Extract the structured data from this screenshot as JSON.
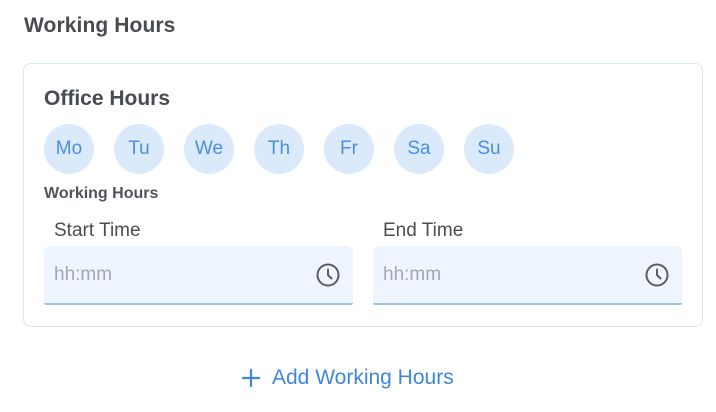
{
  "section": {
    "title": "Working Hours"
  },
  "card": {
    "title": "Office Hours",
    "days": [
      "Mo",
      "Tu",
      "We",
      "Th",
      "Fr",
      "Sa",
      "Su"
    ],
    "subtitle": "Working Hours",
    "start": {
      "label": "Start Time",
      "value": "",
      "placeholder": "hh:mm",
      "icon": "clock-icon"
    },
    "end": {
      "label": "End Time",
      "value": "",
      "placeholder": "hh:mm",
      "icon": "clock-icon"
    }
  },
  "add_button": {
    "icon": "plus-icon",
    "label": "Add Working Hours"
  },
  "colors": {
    "accent": "#3f86e0",
    "day_bg": "#dbeafb",
    "input_bg": "#eef5fe",
    "card_border": "#d7e6f6"
  }
}
